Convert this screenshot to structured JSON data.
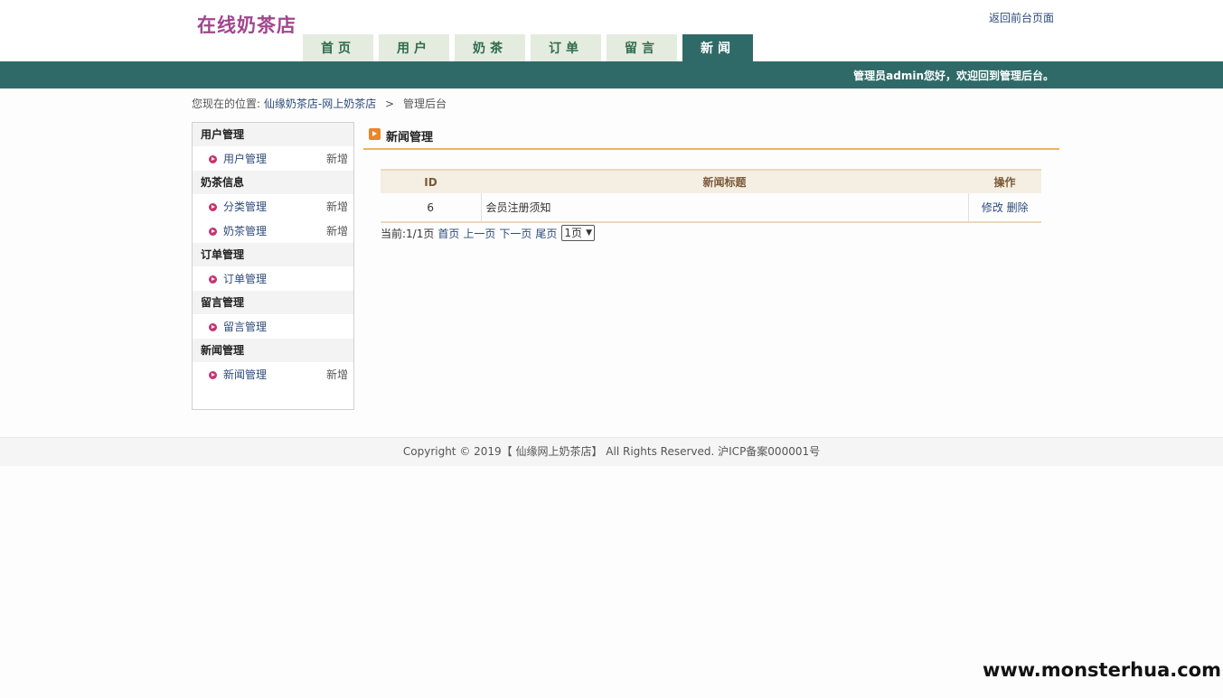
{
  "header": {
    "logo": "在线奶茶店",
    "back_link": "返回前台页面",
    "nav": [
      {
        "label": "首页",
        "active": false
      },
      {
        "label": "用户",
        "active": false
      },
      {
        "label": "奶茶",
        "active": false
      },
      {
        "label": "订单",
        "active": false
      },
      {
        "label": "留言",
        "active": false
      },
      {
        "label": "新闻",
        "active": true
      }
    ],
    "welcome": "管理员admin您好，欢迎回到管理后台。"
  },
  "breadcrumb": {
    "prefix": "您现在的位置:",
    "site": "仙缘奶茶店-网上奶茶店",
    "separator": ">",
    "current": "管理后台"
  },
  "sidebar": {
    "groups": [
      {
        "title": "用户管理",
        "items": [
          {
            "label": "用户管理",
            "add": "新增"
          }
        ]
      },
      {
        "title": "奶茶信息",
        "items": [
          {
            "label": "分类管理",
            "add": "新增"
          },
          {
            "label": "奶茶管理",
            "add": "新增"
          }
        ]
      },
      {
        "title": "订单管理",
        "items": [
          {
            "label": "订单管理",
            "add": ""
          }
        ]
      },
      {
        "title": "留言管理",
        "items": [
          {
            "label": "留言管理",
            "add": ""
          }
        ]
      },
      {
        "title": "新闻管理",
        "items": [
          {
            "label": "新闻管理",
            "add": "新增"
          }
        ]
      }
    ]
  },
  "main": {
    "title": "新闻管理",
    "table": {
      "headers": [
        "ID",
        "新闻标题",
        "操作"
      ],
      "rows": [
        {
          "id": "6",
          "title": "会员注册须知",
          "edit": "修改",
          "delete": "删除"
        }
      ]
    },
    "pager": {
      "status": "当前:1/1页",
      "first": "首页",
      "prev": "上一页",
      "next": "下一页",
      "last": "尾页",
      "select_value": "1页"
    }
  },
  "footer": {
    "text": "Copyright © 2019【 仙缘网上奶茶店】 All Rights Reserved. 沪ICP备案000001号"
  },
  "watermark": "www.monsterhua.com"
}
